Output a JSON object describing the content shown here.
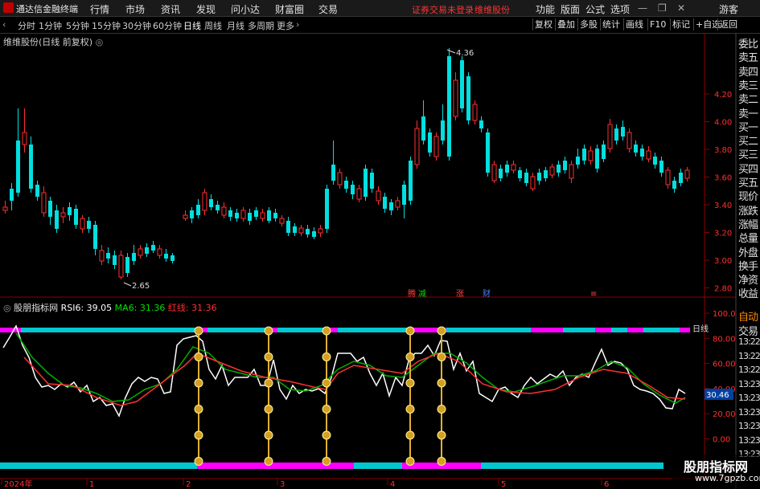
{
  "app": {
    "title": "通达信金融终端",
    "menu": [
      "行情",
      "市场",
      "资讯",
      "发现",
      "问小达",
      "财富圈",
      "交易"
    ],
    "status_login": "证券交易未登录",
    "status_stock": "维维股份",
    "right_menu": [
      "功能",
      "版面",
      "公式",
      "选项"
    ],
    "user": "游客"
  },
  "periods": [
    "分时",
    "1分钟",
    "5分钟",
    "15分钟",
    "30分钟",
    "60分钟",
    "日线",
    "周线",
    "月线",
    "多周期",
    "更多"
  ],
  "active_period": "日线",
  "toolbar": [
    "复权",
    "叠加",
    "多股",
    "统计",
    "画线",
    "F10",
    "标记",
    "+自选",
    "返回"
  ],
  "chart_title": "维维股份(日线 前复权)",
  "price_axis": [
    "4.20",
    "4.00",
    "3.80",
    "3.60",
    "3.40",
    "3.20",
    "3.00",
    "2.80"
  ],
  "price_high_label": "4.36",
  "price_low_label": "2.65",
  "events": [
    {
      "text": "腾",
      "color": "#ff4040"
    },
    {
      "text": "减",
      "color": "#00dd00"
    },
    {
      "text": "涨",
      "color": "#ff4040"
    },
    {
      "text": "财",
      "color": "#4080ff"
    },
    {
      "text": "≡",
      "color": "#ff4040"
    }
  ],
  "indicator": {
    "name": "股朋指标网",
    "rsi_label": "RSI6: 39.05",
    "ma_label": "MA6: 31.36",
    "red_label": "红线: 31.36",
    "axis": [
      "100.0",
      "80.00",
      "60.00",
      "40.00",
      "20.00",
      "0.00"
    ],
    "current_value": "30.46",
    "day_tag": "日线"
  },
  "right_panel": [
    "委比",
    "卖五",
    "卖四",
    "卖三",
    "卖二",
    "卖一",
    "买一",
    "买二",
    "买三",
    "买四",
    "买五",
    "现价",
    "涨跌",
    "涨幅",
    "总量",
    "外盘",
    "换手",
    "净资",
    "收益"
  ],
  "right_panel_lower": [
    "自动",
    "交易",
    "13:22",
    "13:22",
    "13:22",
    "13:23",
    "13:23",
    "13:23",
    "13:23",
    "13:23",
    "13:23"
  ],
  "date_axis": [
    "2024年",
    "1",
    "2",
    "3",
    "4",
    "5",
    "6"
  ],
  "watermark": {
    "line1": "股朋指标网",
    "line2": "www.7gpzb.com"
  },
  "colors": {
    "up": "#ff3030",
    "down": "#00e0e0",
    "magenta": "#ff00ff",
    "cyan": "#00c8d0",
    "white": "#ffffff",
    "orange": "#ff8c00",
    "gold": "#e0b030"
  }
}
